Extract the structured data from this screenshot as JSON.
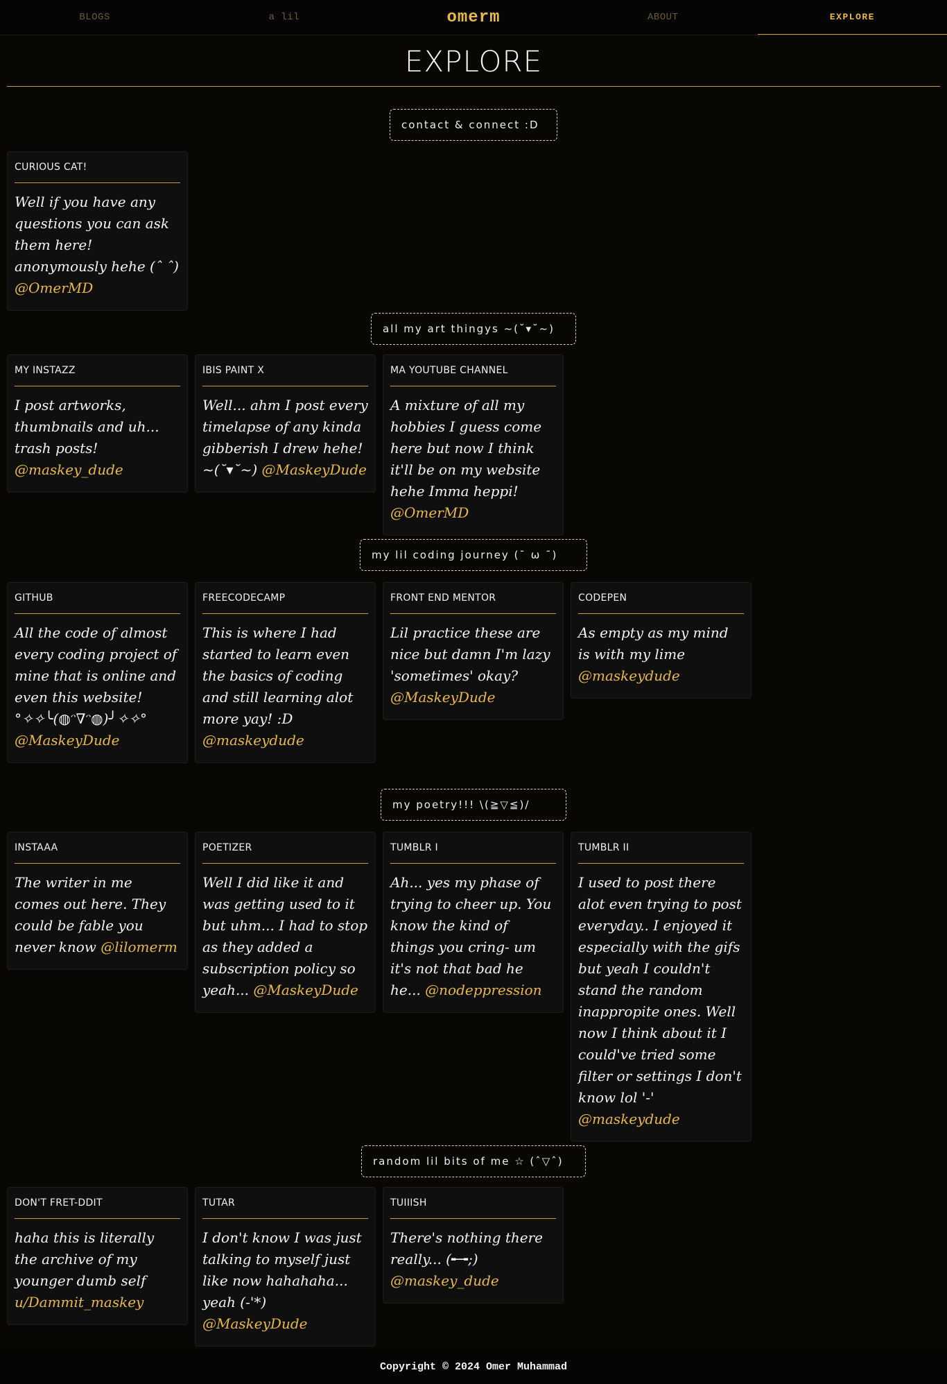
{
  "nav": {
    "blogs": "BLOGS",
    "lil": "a lil",
    "brand": "omerm",
    "about": "ABOUT",
    "explore": "EXPLORE"
  },
  "page": {
    "title": "EXPLORE"
  },
  "sections": [
    {
      "heading": "contact & connect :D",
      "cards": [
        {
          "title": "Curious Cat!",
          "text": "Well if you have any questions you can ask them here! anonymously hehe (ˆ ˆ) ",
          "handle": "@OmerMD"
        }
      ]
    },
    {
      "heading": "all my art thingys ~(˘▾˘~)",
      "cards": [
        {
          "title": "My Instazz",
          "text": "I post artworks, thumbnails and uh... trash posts! ",
          "handle": "@maskey_dude"
        },
        {
          "title": "Ibis Paint X",
          "text": "Well... ahm I post every timelapse of any kinda gibberish I drew hehe! ~(˘▾˘~) ",
          "handle": "@MaskeyDude"
        },
        {
          "title": "Ma YouTube Channel",
          "text": "A mixture of all my hobbies I guess come here but now I think it'll be on my website hehe Imma heppi! ",
          "handle": "@OmerMD"
        }
      ]
    },
    {
      "heading": "my lil coding journey (¯ ω ¯)",
      "cards": [
        {
          "title": "GitHub",
          "text": "All the code of almost every coding project of mine that is online and even this website! °✧✧╰(◍ᵔ∇ᵔ◍)╯✧✧° ",
          "handle": "@MaskeyDude"
        },
        {
          "title": "FreeCodeCamp",
          "text": "This is where I had started to learn even the basics of coding and still learning alot more yay! :D ",
          "handle": "@maskeydude"
        },
        {
          "title": "Front End Mentor",
          "text": "Lil practice these are nice but damn I'm lazy 'sometimes' okay? ",
          "handle": "@MaskeyDude"
        },
        {
          "title": "CodePen",
          "text": "As empty as my mind is with my lime ",
          "handle": "@maskeydude"
        }
      ]
    },
    {
      "heading": "my poetry!!! \\(≧▽≦)/",
      "cards": [
        {
          "title": "Instaaa",
          "text": "The writer in me comes out here. They could be fable you never know ",
          "handle": "@lilomerm"
        },
        {
          "title": "Poetizer",
          "text": "Well I did like it and was getting used to it but uhm... I had to stop as they added a subscription policy so yeah... ",
          "handle": "@MaskeyDude"
        },
        {
          "title": "Tumblr I",
          "text": "Ah... yes my phase of trying to cheer up. You know the kind of things you cring- um it's not that bad he he... ",
          "handle": "@nodeppression"
        },
        {
          "title": "Tumblr II",
          "text": "I used to post there alot even trying to post everyday.. I enjoyed it especially with the gifs but yeah I couldn't stand the random inappropite ones. Well now I think about it I could've tried some filter or settings I don't know lol '-' ",
          "handle": "@maskeydude"
        }
      ]
    },
    {
      "heading": "random lil bits of me ☆ (ˆ▽ˆ)",
      "cards": [
        {
          "title": "Don't Fret-ddit",
          "text": "haha this is literally the archive of my younger dumb self ",
          "handle": "u/Dammit_maskey"
        },
        {
          "title": "Tutar",
          "text": "I don't know I was just talking to myself just like now hahahaha... yeah (-'*) ",
          "handle": "@MaskeyDude"
        },
        {
          "title": "Tuiiish",
          "text": "There's nothing there really... (╾╼;) ",
          "handle": "@maskey_dude"
        }
      ]
    }
  ],
  "footer": {
    "text": "Copyright © 2024 Omer Muhammad"
  }
}
